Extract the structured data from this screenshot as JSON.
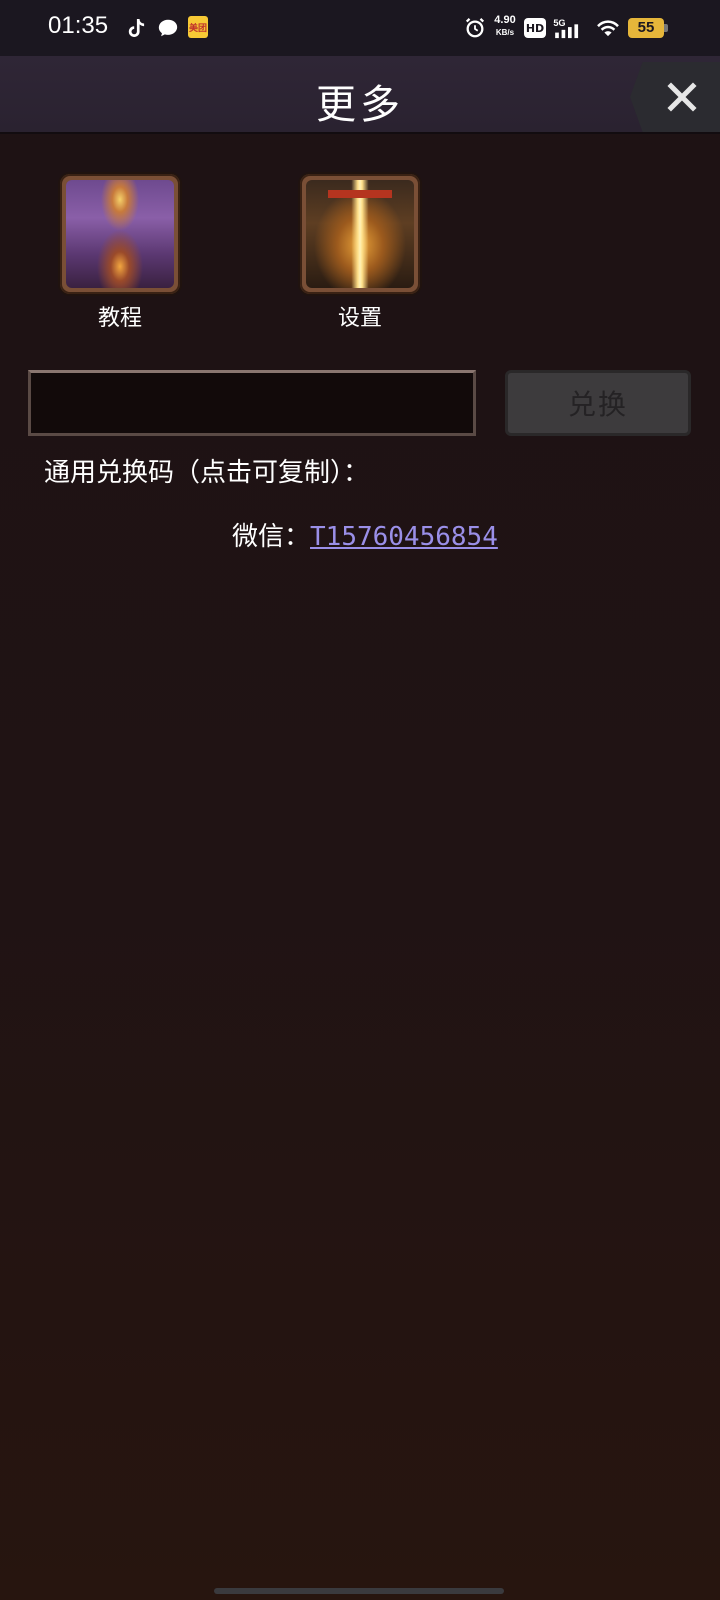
{
  "status_bar": {
    "time": "01:35",
    "speed_value": "4.90",
    "speed_unit": "KB/s",
    "hd_label": "HD",
    "network": "5G",
    "battery": "55"
  },
  "header": {
    "title": "更多",
    "close_icon": "close-icon"
  },
  "tiles": [
    {
      "label": "教程",
      "icon": "tutorial-icon"
    },
    {
      "label": "设置",
      "icon": "settings-icon"
    }
  ],
  "redeem": {
    "input_value": "",
    "input_placeholder": "",
    "button_label": "兑换",
    "note": "通用兑换码（点击可复制）："
  },
  "contact": {
    "label": "微信：",
    "value": "T15760456854"
  },
  "colors": {
    "link": "#9a8fe8",
    "header_bg": "#2f2636",
    "tile_frame": "#7a4f36"
  }
}
